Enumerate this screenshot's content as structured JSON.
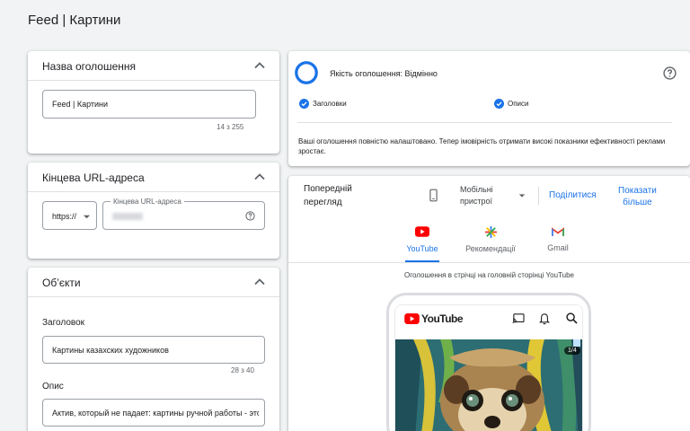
{
  "page": {
    "title": "Feed | Картини"
  },
  "ad_name": {
    "title": "Назва оголошення",
    "value": "Feed | Картини",
    "counter": "14 з 255"
  },
  "final_url": {
    "title": "Кінцева URL-адреса",
    "protocol": "https://",
    "field_label": "Кінцева URL-адреса"
  },
  "assets": {
    "title": "Об’єкти",
    "headline_label": "Заголовок",
    "headline_value": "Картины казахских художников",
    "headline_counter": "28 з 40",
    "description_label": "Опис",
    "description_value": "Актив, который не падает: картины ручной работы - это"
  },
  "ad_strength": {
    "title": "Якість оголошення: Відмінно",
    "checks": [
      "Заголовки",
      "Описи"
    ],
    "message": "Ваші оголошення повністю налаштовано. Тепер імовірність отримати високі показники ефективності реклами зростає."
  },
  "preview": {
    "title_line1": "Попередній",
    "title_line2": "перегляд",
    "device_line1": "Мобільні",
    "device_line2": "пристрої",
    "share": "Поділитися",
    "show_more_line1": "Показати",
    "show_more_line2": "більше",
    "tabs": [
      "YouTube",
      "Рекомендації",
      "Gmail"
    ],
    "caption": "Оголошення в стрічці на головній сторінці YouTube",
    "yt_brand": "YouTube",
    "image_counter": "1/4"
  },
  "colors": {
    "accent": "#1a73e8",
    "youtube_red": "#ff0000"
  },
  "icons": [
    "chevron-up-icon",
    "help-icon",
    "check-circle-icon",
    "phone-icon",
    "dropdown-arrow-icon",
    "cast-icon",
    "bell-icon",
    "search-icon",
    "gmail-icon",
    "discover-icon"
  ]
}
